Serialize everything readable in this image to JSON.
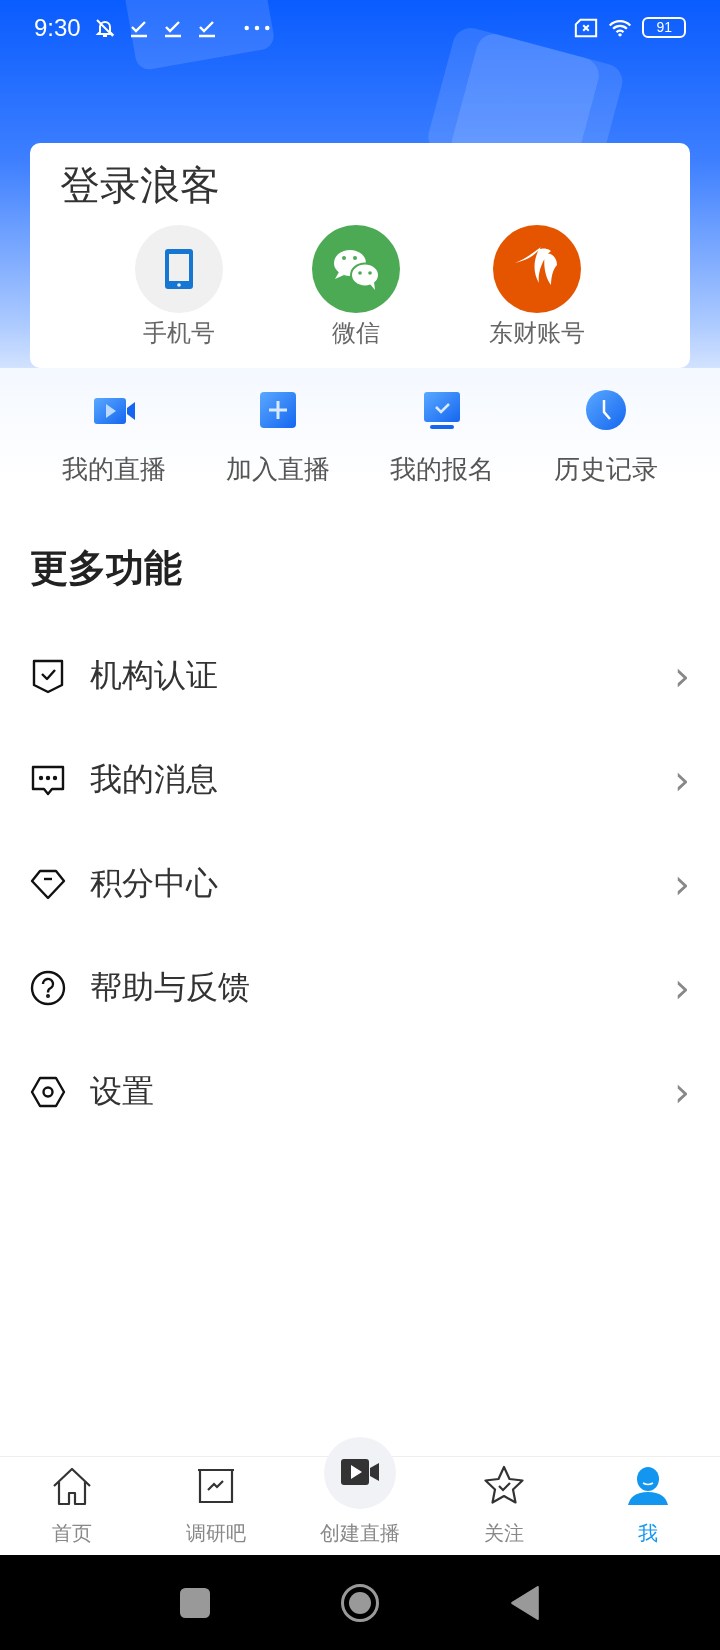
{
  "status_bar": {
    "time": "9:30",
    "battery": "91"
  },
  "login": {
    "title": "登录浪客",
    "methods": [
      {
        "label": "手机号"
      },
      {
        "label": "微信"
      },
      {
        "label": "东财账号"
      }
    ]
  },
  "shortcuts": [
    {
      "label": "我的直播"
    },
    {
      "label": "加入直播"
    },
    {
      "label": "我的报名"
    },
    {
      "label": "历史记录"
    }
  ],
  "more": {
    "title": "更多功能",
    "items": [
      {
        "label": "机构认证",
        "chevron": "›"
      },
      {
        "label": "我的消息",
        "chevron": "›"
      },
      {
        "label": "积分中心",
        "chevron": "›"
      },
      {
        "label": "帮助与反馈",
        "chevron": "›"
      },
      {
        "label": "设置",
        "chevron": "›"
      }
    ]
  },
  "tab_bar": [
    {
      "label": "首页",
      "selected": false
    },
    {
      "label": "调研吧",
      "selected": false
    },
    {
      "label": "创建直播",
      "selected": false
    },
    {
      "label": "关注",
      "selected": false
    },
    {
      "label": "我",
      "selected": true
    }
  ]
}
